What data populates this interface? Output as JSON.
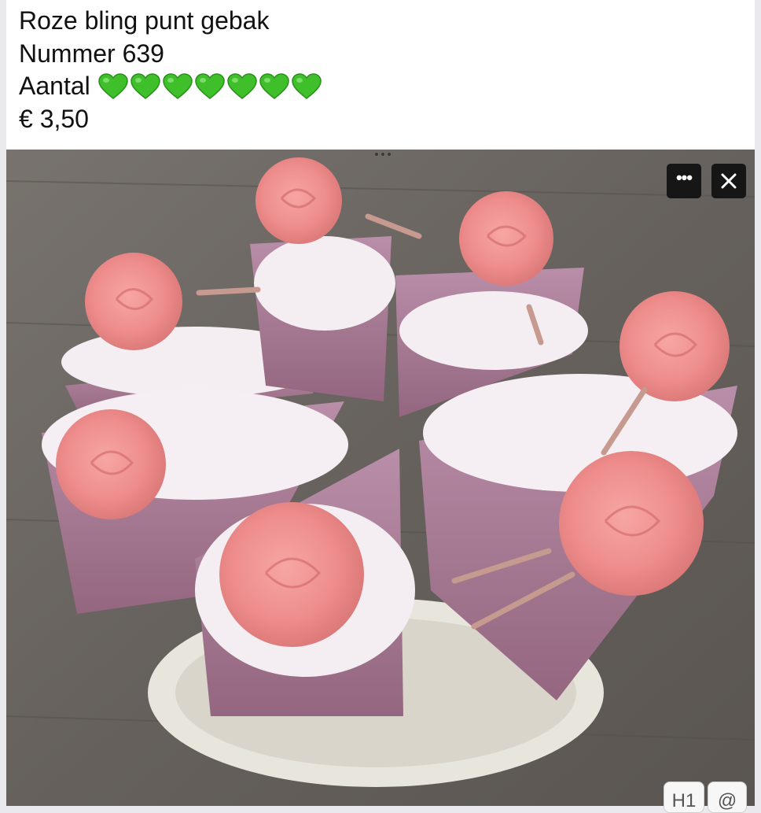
{
  "caption": {
    "title": "Roze bling punt gebak",
    "number": "Nummer 639",
    "quantity_label": "Aantal",
    "quantity_hearts": 7,
    "heart_icon": "green-heart-emoji",
    "heart_color": "#3fbf2a",
    "price": "€ 3,50"
  },
  "photo": {
    "more_icon": "more-dots-icon",
    "close_icon": "close-icon"
  },
  "badges": {
    "h1": "H1",
    "at": "@"
  }
}
